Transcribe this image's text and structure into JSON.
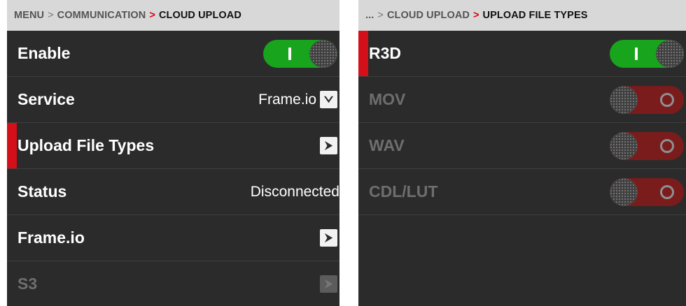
{
  "left_panel": {
    "breadcrumb": {
      "path1": "MENU",
      "path2": "COMMUNICATION",
      "current": "CLOUD UPLOAD"
    },
    "rows": [
      {
        "label": "Enable",
        "toggle": "on"
      },
      {
        "label": "Service",
        "value": "Frame.io"
      },
      {
        "label": "Upload File Types",
        "selected": true
      },
      {
        "label": "Status",
        "value": "Disconnected"
      },
      {
        "label": "Frame.io"
      },
      {
        "label": "S3",
        "disabled": true
      }
    ]
  },
  "right_panel": {
    "breadcrumb": {
      "path1": "...",
      "path2": "CLOUD UPLOAD",
      "current": "UPLOAD FILE TYPES"
    },
    "rows": [
      {
        "label": "R3D",
        "toggle": "on",
        "selected": true
      },
      {
        "label": "MOV",
        "toggle": "off",
        "disabled": true
      },
      {
        "label": "WAV",
        "toggle": "off",
        "disabled": true
      },
      {
        "label": "CDL/LUT",
        "toggle": "off",
        "disabled": true
      }
    ]
  },
  "separators": {
    "plain": ">",
    "active": ">"
  },
  "icons": {
    "dropdown": "chevron-down-icon",
    "navigate": "chevron-right-icon",
    "toggle_knob": "toggle-knob"
  },
  "colors": {
    "accent_red": "#d30f1a",
    "toggle_on": "#18a41d",
    "toggle_off": "#7a1c1c",
    "panel_bg": "#2b2b2b",
    "breadcrumb_bg": "#d8d8d8"
  }
}
